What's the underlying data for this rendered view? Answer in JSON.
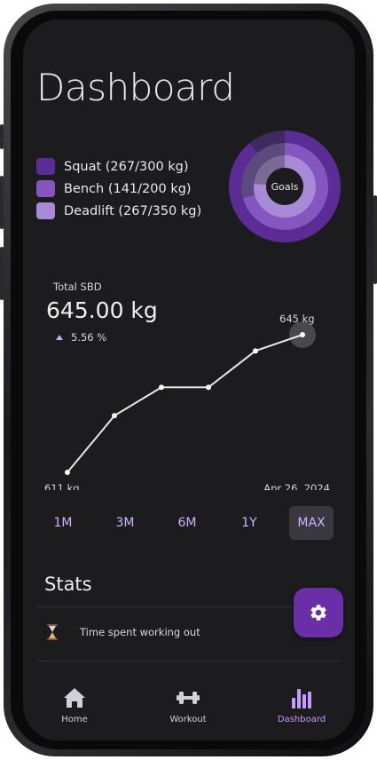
{
  "header": {
    "title": "Dashboard"
  },
  "goals": {
    "center_label": "Goals",
    "items": [
      {
        "label": "Squat (267/300 kg)",
        "value": 267,
        "goal": 300,
        "color": "#5b2b96"
      },
      {
        "label": "Bench (141/200 kg)",
        "value": 141,
        "goal": 200,
        "color": "#8457c0"
      },
      {
        "label": "Deadlift (267/350 kg)",
        "value": 267,
        "goal": 350,
        "color": "#a88ad6"
      }
    ]
  },
  "summary": {
    "label": "Total SBD",
    "value": "645.00 kg",
    "change": "5.56 %"
  },
  "chart_data": {
    "type": "line",
    "values": [
      611,
      625,
      632,
      632,
      641,
      645
    ],
    "ylim": [
      611,
      645
    ],
    "start_label": "611 kg",
    "end_label": "645 kg",
    "end_date": "Apr 26, 2024",
    "line_color": "#e8e6ea"
  },
  "ranges": {
    "items": [
      "1M",
      "3M",
      "6M",
      "1Y",
      "MAX"
    ],
    "selected": "MAX"
  },
  "stats": {
    "title": "Stats",
    "rows": [
      {
        "label": "Time spent working out",
        "icon": "hourglass-icon"
      }
    ]
  },
  "fab": {
    "icon": "gear-icon"
  },
  "nav": {
    "home": "Home",
    "workout": "Workout",
    "dashboard": "Dashboard",
    "active": "dashboard"
  },
  "colors": {
    "accent": "#6a2fa8",
    "accent_light": "#c79bff",
    "background": "#1c1b1e"
  }
}
